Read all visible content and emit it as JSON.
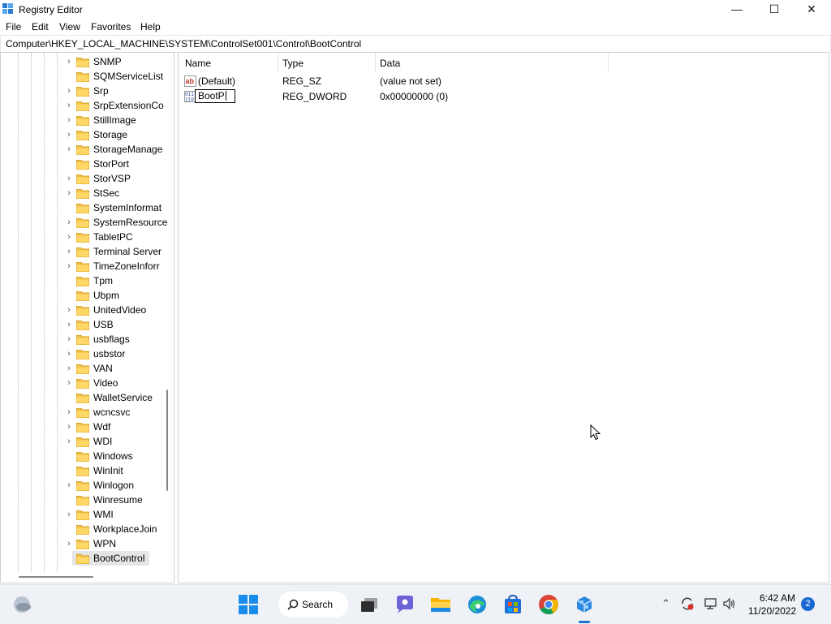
{
  "window": {
    "title": "Registry Editor",
    "controls": {
      "minimize": "—",
      "maximize": "☐",
      "close": "✕"
    }
  },
  "menu": [
    "File",
    "Edit",
    "View",
    "Favorites",
    "Help"
  ],
  "address": "Computer\\HKEY_LOCAL_MACHINE\\SYSTEM\\ControlSet001\\Control\\BootControl",
  "tree": {
    "items": [
      {
        "label": "SNMP",
        "expandable": true
      },
      {
        "label": "SQMServiceList",
        "expandable": false
      },
      {
        "label": "Srp",
        "expandable": true
      },
      {
        "label": "SrpExtensionCo",
        "expandable": true
      },
      {
        "label": "StillImage",
        "expandable": true
      },
      {
        "label": "Storage",
        "expandable": true
      },
      {
        "label": "StorageManage",
        "expandable": true
      },
      {
        "label": "StorPort",
        "expandable": false
      },
      {
        "label": "StorVSP",
        "expandable": true
      },
      {
        "label": "StSec",
        "expandable": true
      },
      {
        "label": "SystemInformat",
        "expandable": false
      },
      {
        "label": "SystemResource",
        "expandable": true
      },
      {
        "label": "TabletPC",
        "expandable": true
      },
      {
        "label": "Terminal Server",
        "expandable": true
      },
      {
        "label": "TimeZoneInforr",
        "expandable": true
      },
      {
        "label": "Tpm",
        "expandable": false
      },
      {
        "label": "Ubpm",
        "expandable": false
      },
      {
        "label": "UnitedVideo",
        "expandable": true
      },
      {
        "label": "USB",
        "expandable": true
      },
      {
        "label": "usbflags",
        "expandable": true
      },
      {
        "label": "usbstor",
        "expandable": true
      },
      {
        "label": "VAN",
        "expandable": true
      },
      {
        "label": "Video",
        "expandable": true
      },
      {
        "label": "WalletService",
        "expandable": false
      },
      {
        "label": "wcncsvc",
        "expandable": true
      },
      {
        "label": "Wdf",
        "expandable": true
      },
      {
        "label": "WDI",
        "expandable": true
      },
      {
        "label": "Windows",
        "expandable": false
      },
      {
        "label": "WinInit",
        "expandable": false
      },
      {
        "label": "Winlogon",
        "expandable": true
      },
      {
        "label": "Winresume",
        "expandable": false
      },
      {
        "label": "WMI",
        "expandable": true
      },
      {
        "label": "WorkplaceJoin",
        "expandable": false
      },
      {
        "label": "WPN",
        "expandable": true
      },
      {
        "label": "BootControl",
        "expandable": false,
        "selected": true
      }
    ]
  },
  "list": {
    "columns": [
      "Name",
      "Type",
      "Data"
    ],
    "rows": [
      {
        "name": "(Default)",
        "type": "REG_SZ",
        "data": "(value not set)",
        "icon": "string-value-icon"
      },
      {
        "name": "BootP",
        "type": "REG_DWORD",
        "data": "0x00000000 (0)",
        "icon": "binary-value-icon",
        "editing": true
      }
    ]
  },
  "taskbar": {
    "search_label": "Search",
    "apps": [
      "start-icon",
      "search-icon",
      "task-view-icon",
      "chat-icon",
      "file-explorer-icon",
      "edge-icon",
      "store-icon",
      "chrome-icon",
      "registry-editor-icon"
    ],
    "time": "6:42 AM",
    "date": "11/20/2022",
    "notifications": "2"
  }
}
